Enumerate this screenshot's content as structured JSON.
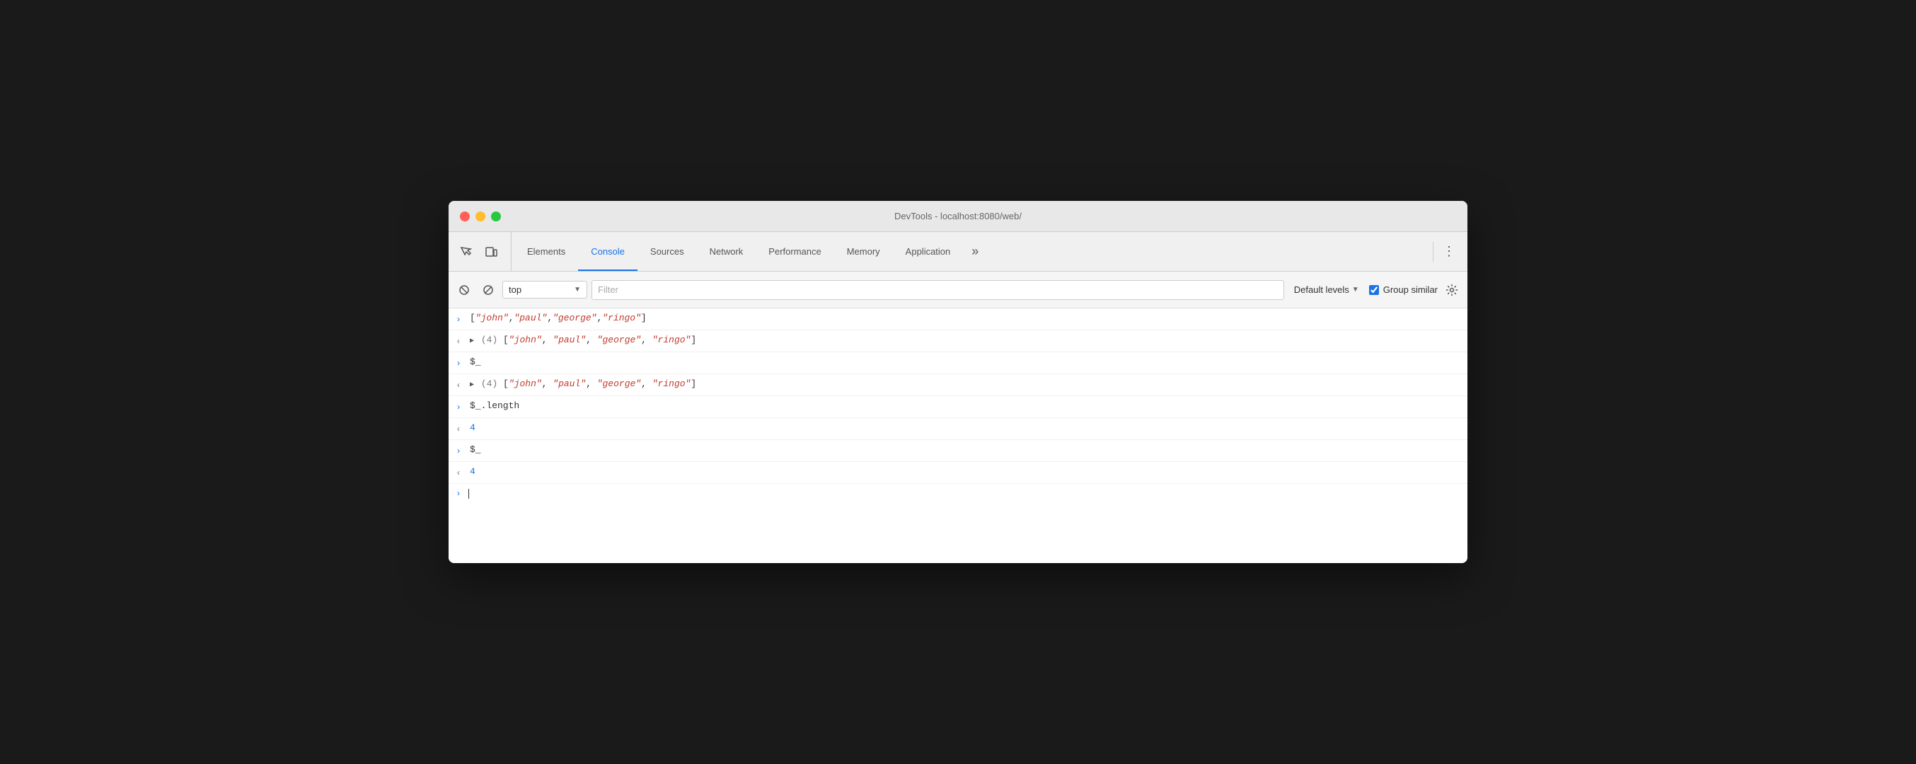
{
  "window": {
    "title": "DevTools - localhost:8080/web/"
  },
  "tabs": {
    "items": [
      {
        "id": "elements",
        "label": "Elements",
        "active": false
      },
      {
        "id": "console",
        "label": "Console",
        "active": true
      },
      {
        "id": "sources",
        "label": "Sources",
        "active": false
      },
      {
        "id": "network",
        "label": "Network",
        "active": false
      },
      {
        "id": "performance",
        "label": "Performance",
        "active": false
      },
      {
        "id": "memory",
        "label": "Memory",
        "active": false
      },
      {
        "id": "application",
        "label": "Application",
        "active": false
      }
    ],
    "more_label": "»"
  },
  "console_toolbar": {
    "top_label": "top",
    "filter_placeholder": "Filter",
    "levels_label": "Default levels",
    "group_similar_label": "Group similar",
    "group_similar_checked": true
  },
  "console_lines": [
    {
      "id": "line1",
      "arrow_type": "input",
      "arrow": "›",
      "content_html": "[\"john\",\"paul\",\"george\",\"ringo\"]"
    },
    {
      "id": "line2",
      "arrow_type": "output_expandable",
      "arrow": "‹",
      "has_triangle": true,
      "count": "(4)",
      "content_html": "[<span class=\"str-val\">\"john\"</span>, <span class=\"str-val\">\"paul\"</span>, <span class=\"str-val\">\"george\"</span>, <span class=\"str-val\">\"ringo\"</span>]"
    },
    {
      "id": "line3",
      "arrow_type": "input",
      "arrow": "›",
      "content_html": "$_"
    },
    {
      "id": "line4",
      "arrow_type": "output_expandable",
      "arrow": "‹",
      "has_triangle": true,
      "count": "(4)",
      "content_html": "[<span class=\"str-val\">\"john\"</span>, <span class=\"str-val\">\"paul\"</span>, <span class=\"str-val\">\"george\"</span>, <span class=\"str-val\">\"ringo\"</span>]"
    },
    {
      "id": "line5",
      "arrow_type": "input",
      "arrow": "›",
      "content_html": "$_.length"
    },
    {
      "id": "line6",
      "arrow_type": "output",
      "arrow": "‹",
      "content_html": "<span class=\"num-val\">4</span>"
    },
    {
      "id": "line7",
      "arrow_type": "input",
      "arrow": "›",
      "content_html": "$_"
    },
    {
      "id": "line8",
      "arrow_type": "output",
      "arrow": "‹",
      "content_html": "<span class=\"num-val\">4</span>"
    }
  ]
}
